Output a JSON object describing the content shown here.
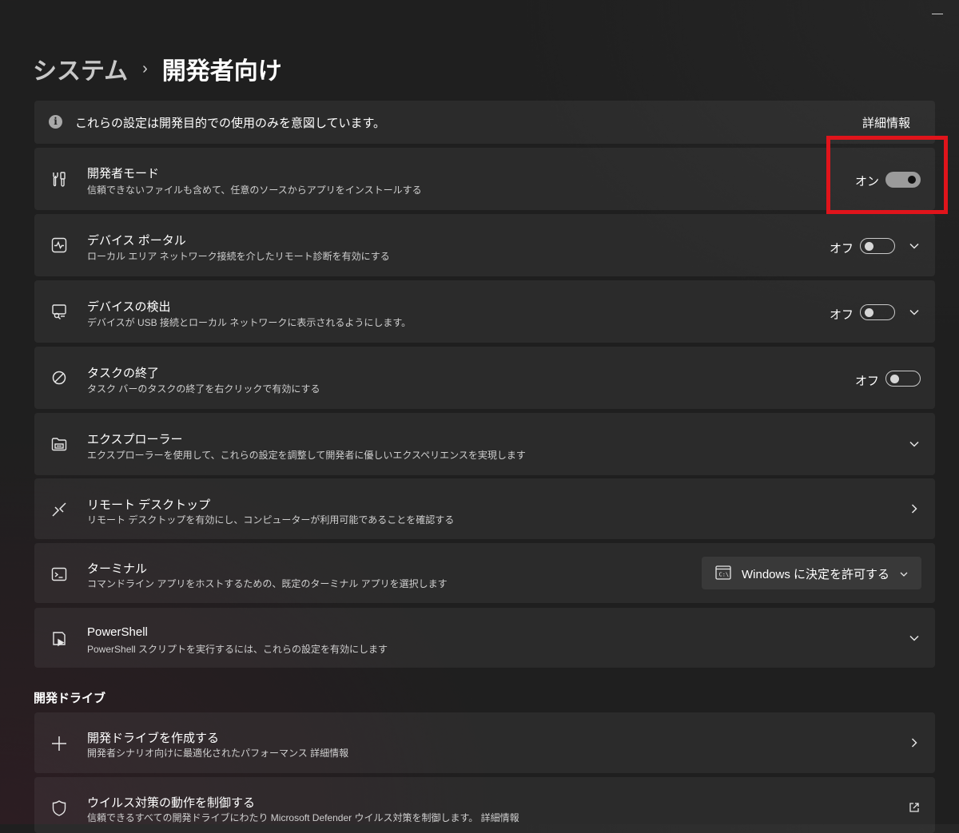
{
  "breadcrumb": {
    "parent": "システム",
    "separator": "›",
    "current": "開発者向け"
  },
  "info": {
    "text": "これらの設定は開発目的での使用のみを意図しています。",
    "link": "詳細情報"
  },
  "rows": {
    "developer_mode": {
      "title": "開発者モード",
      "desc": "信頼できないファイルも含めて、任意のソースからアプリをインストールする",
      "state": "オン",
      "on": true
    },
    "device_portal": {
      "title": "デバイス ポータル",
      "desc": "ローカル エリア ネットワーク接続を介したリモート診断を有効にする",
      "state": "オフ",
      "on": false
    },
    "device_discovery": {
      "title": "デバイスの検出",
      "desc": "デバイスが USB 接続とローカル ネットワークに表示されるようにします。",
      "state": "オフ",
      "on": false
    },
    "end_task": {
      "title": "タスクの終了",
      "desc": "タスク バーのタスクの終了を右クリックで有効にする",
      "state": "オフ",
      "on": false
    },
    "explorer": {
      "title": "エクスプローラー",
      "desc": "エクスプローラーを使用して、これらの設定を調整して開発者に優しいエクスペリエンスを実現します"
    },
    "remote_desktop": {
      "title": "リモート デスクトップ",
      "desc": "リモート デスクトップを有効にし、コンピューターが利用可能であることを確認する"
    },
    "terminal": {
      "title": "ターミナル",
      "desc": "コマンドライン アプリをホストするための、既定のターミナル アプリを選択します",
      "dropdown_value": "Windows に決定を許可する"
    },
    "powershell": {
      "title": "PowerShell",
      "desc": "PowerShell スクリプトを実行するには、これらの設定を有効にします"
    }
  },
  "dev_drive_section": {
    "label": "開発ドライブ",
    "create": {
      "title": "開発ドライブを作成する",
      "desc": "開発者シナリオ向けに最適化されたパフォーマンス 詳細情報"
    },
    "antivirus": {
      "title": "ウイルス対策の動作を制御する",
      "desc": "信頼できるすべての開発ドライブにわたり Microsoft Defender ウイルス対策を制御します。 詳細情報"
    }
  },
  "colors": {
    "highlight": "#e0141b",
    "background": "#1f1f1f",
    "card": "#2b2b2b"
  },
  "icons": [
    "info-icon",
    "developer-tools-icon",
    "device-portal-icon",
    "device-discovery-icon",
    "end-task-icon",
    "explorer-folder-icon",
    "remote-desktop-icon",
    "terminal-icon",
    "powershell-icon",
    "plus-icon",
    "shield-icon",
    "chevron-down-icon",
    "chevron-right-icon",
    "external-link-icon"
  ]
}
